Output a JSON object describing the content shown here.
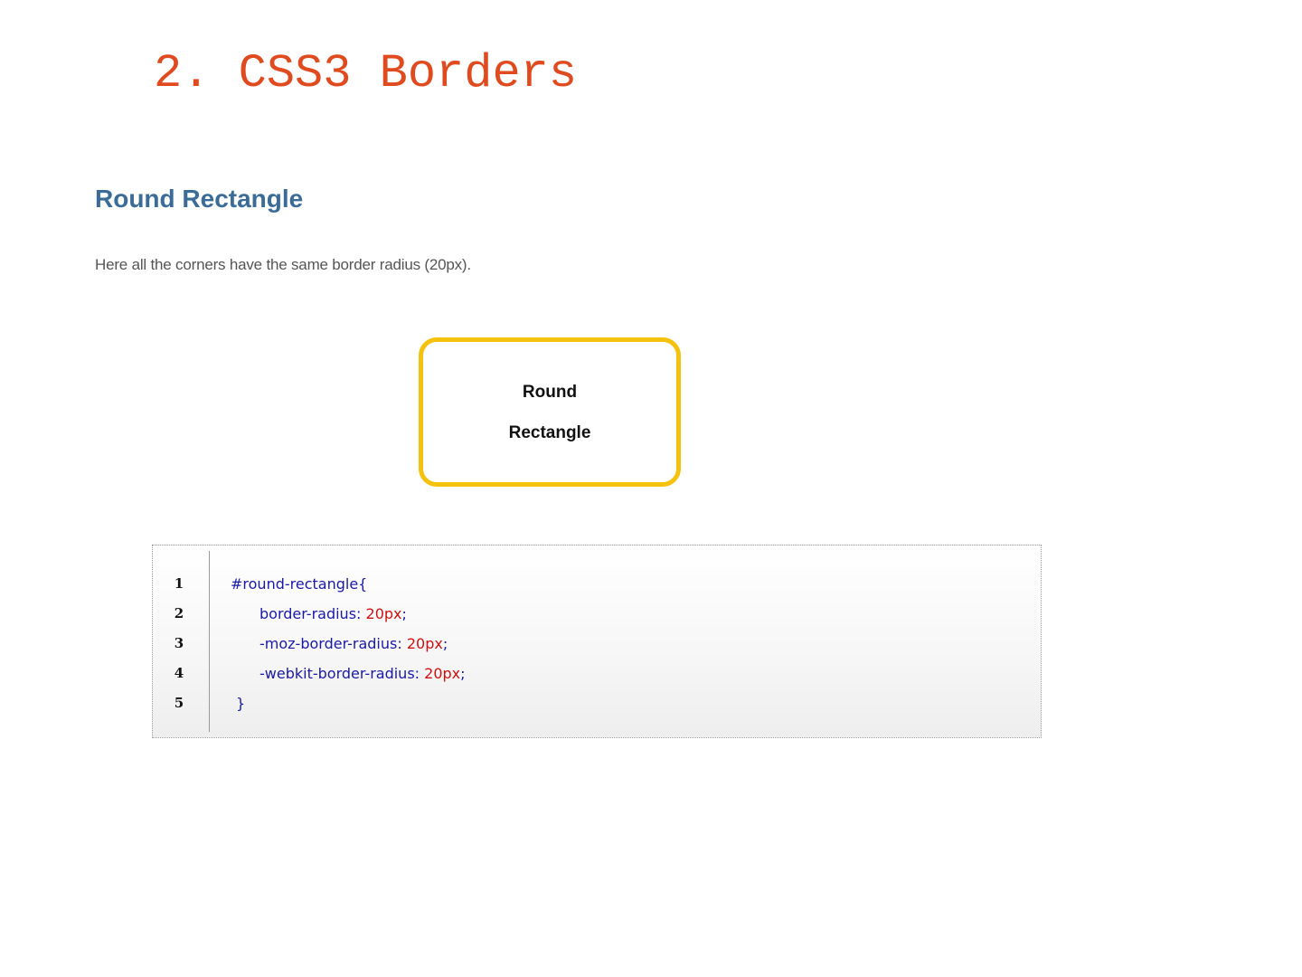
{
  "slide": {
    "title": "2. CSS3 Borders"
  },
  "section": {
    "heading": "Round Rectangle",
    "description": "Here all the corners have the same border radius (20px)."
  },
  "demo": {
    "line1": "Round",
    "line2": "Rectangle",
    "border_color": "#f4c20d"
  },
  "code": {
    "lines": [
      {
        "number": "1",
        "selector": "#round-rectangle{"
      },
      {
        "number": "2",
        "property": "border-radius:",
        "value": "20px",
        "end": ";"
      },
      {
        "number": "3",
        "property": "-moz-border-radius:",
        "value": "20px",
        "end": ";"
      },
      {
        "number": "4",
        "property": "-webkit-border-radius:",
        "value": "20px",
        "end": ";"
      },
      {
        "number": "5",
        "brace": "}"
      }
    ]
  },
  "colors": {
    "title": "#e04a1f",
    "heading": "#3b6c98",
    "code_keyword": "#1a1aa6",
    "code_value": "#d01010"
  }
}
